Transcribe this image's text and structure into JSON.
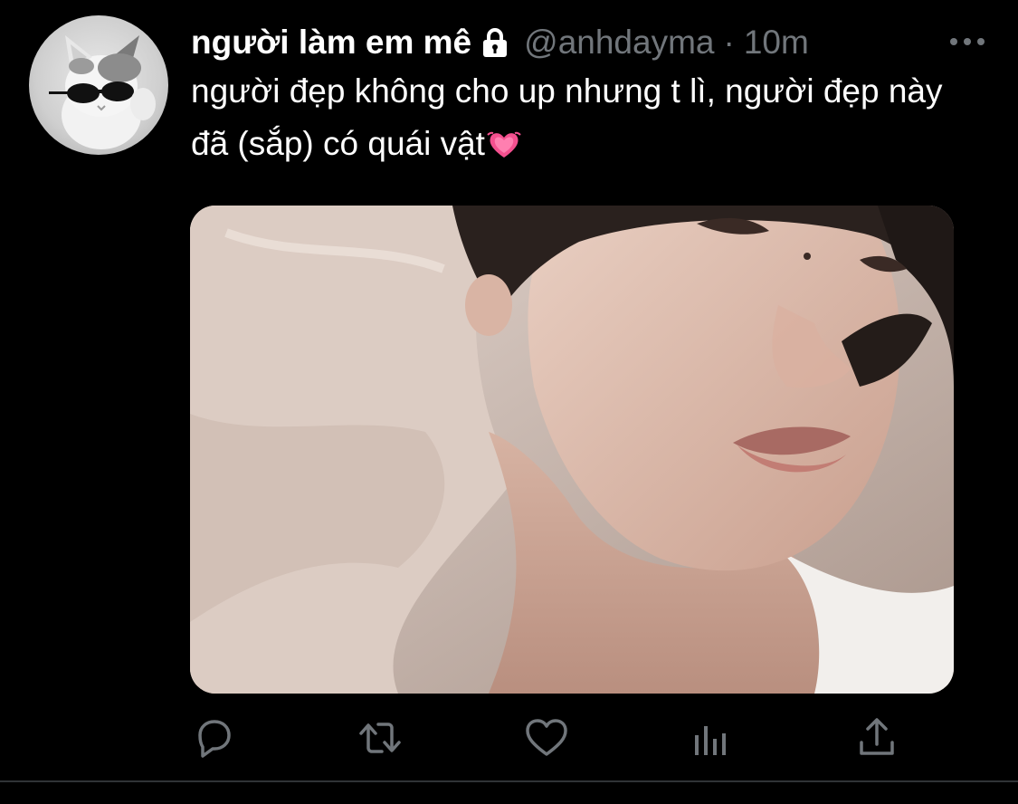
{
  "tweet": {
    "display_name": "người làm em mê",
    "handle": "@anhdayma",
    "separator": "·",
    "time": "10m",
    "text": "người đẹp không cho up nhưng t lì, người đẹp này đã (sắp) có quái vật",
    "emoji": "growing-heart-emoji",
    "author_avatar_icon": "cat-with-sunglasses-avatar",
    "protected_icon": "lock-icon",
    "more_icon": "more-options-icon",
    "media": {
      "kind": "photo",
      "alt": ""
    }
  },
  "actions": [
    {
      "name": "reply",
      "icon": "reply-icon"
    },
    {
      "name": "retweet",
      "icon": "retweet-icon"
    },
    {
      "name": "like",
      "icon": "heart-icon"
    },
    {
      "name": "analytics",
      "icon": "analytics-icon"
    },
    {
      "name": "share",
      "icon": "share-icon"
    }
  ],
  "colors": {
    "background": "#000000",
    "primary_text": "#ffffff",
    "secondary_text": "#71767b",
    "icon": "#71767b",
    "divider": "#2f3336",
    "heart_emoji": "#f4508f"
  }
}
